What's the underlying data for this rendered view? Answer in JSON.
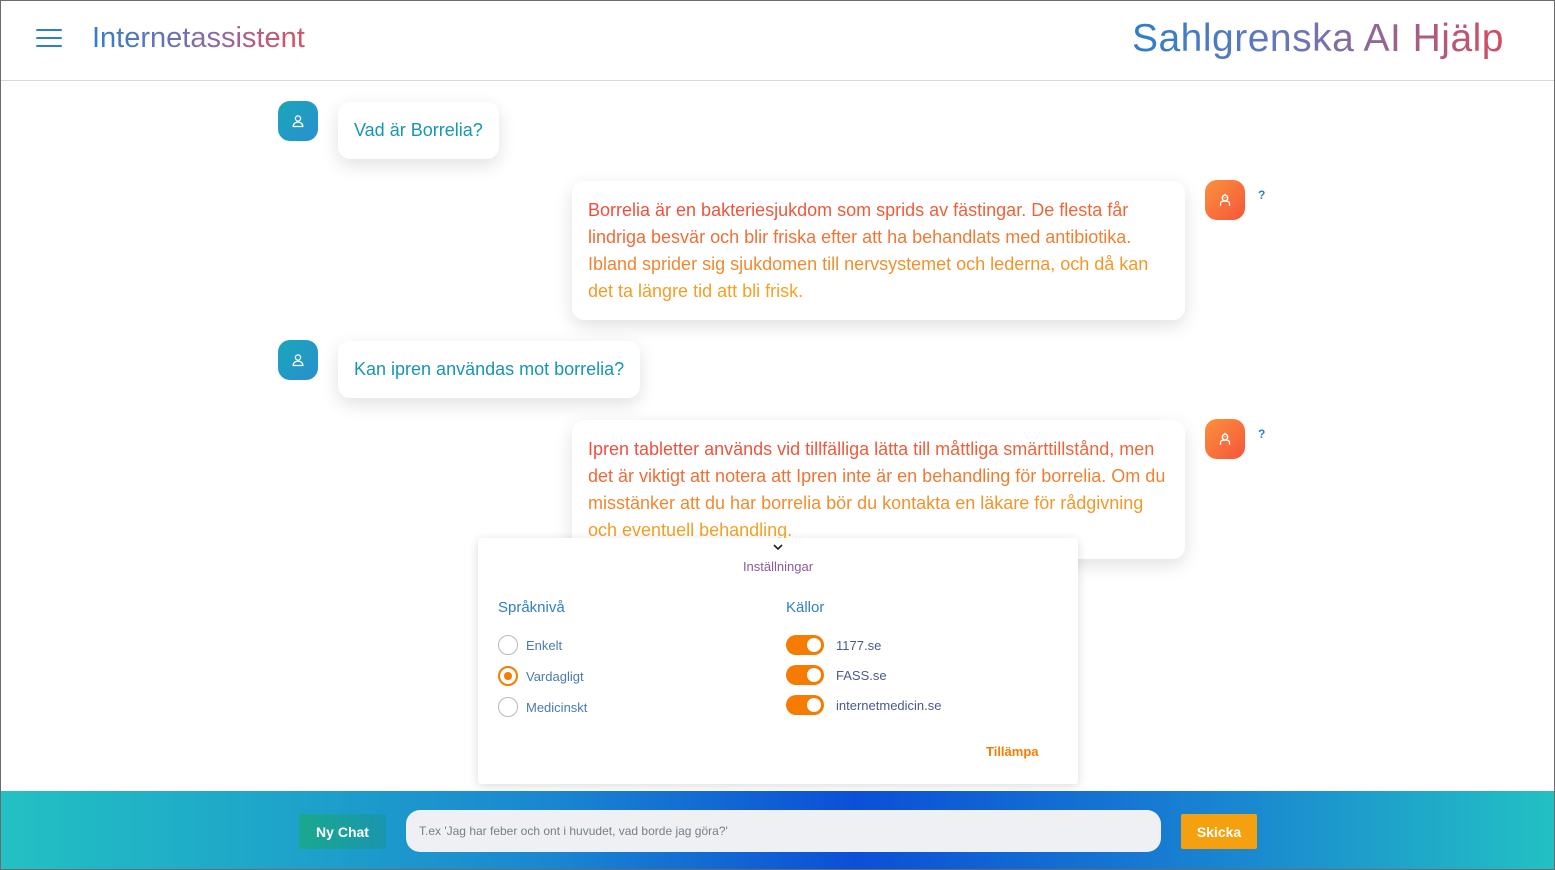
{
  "header": {
    "menu_icon": "hamburger-menu-icon",
    "app_title": "Internetassistent",
    "brand_title": "Sahlgrenska AI Hjälp"
  },
  "messages": [
    {
      "role": "user",
      "icon": "user-icon",
      "text": "Vad är Borrelia?"
    },
    {
      "role": "assistant",
      "icon": "robot-icon",
      "help": "?",
      "text": "Borrelia är en bakteriesjukdom som sprids av fästingar. De flesta får lindriga besvär och blir friska efter att ha behandlats med antibiotika. Ibland sprider sig sjukdomen till nervsystemet och lederna, och då kan det ta längre tid att bli frisk."
    },
    {
      "role": "user",
      "icon": "user-icon",
      "text": "Kan ipren användas mot borrelia?"
    },
    {
      "role": "assistant",
      "icon": "robot-icon",
      "help": "?",
      "text": "Ipren tabletter används vid tillfälliga lätta till måttliga smärttillstånd, men det är viktigt att notera att Ipren inte är en behandling för borrelia. Om du misstänker att du har borrelia bör du kontakta en läkare för rådgivning och eventuell behandling."
    }
  ],
  "settings": {
    "title": "Inställningar",
    "language_level": {
      "title": "Språknivå",
      "options": [
        "Enkelt",
        "Vardagligt",
        "Medicinskt"
      ],
      "selected": "Vardagligt"
    },
    "sources": {
      "title": "Källor",
      "items": [
        {
          "label": "1177.se",
          "enabled": true
        },
        {
          "label": "FASS.se",
          "enabled": true
        },
        {
          "label": "internetmedicin.se",
          "enabled": true
        }
      ]
    },
    "apply_label": "Tillämpa"
  },
  "footer": {
    "new_chat_label": "Ny Chat",
    "input_placeholder": "T.ex 'Jag har feber och ont i huvudet, vad borde jag göra?'",
    "input_value": "",
    "send_label": "Skicka"
  },
  "colors": {
    "accent_orange": "#f57c00",
    "brand_blue": "#2f7fc9",
    "user_text": "#1795b5"
  }
}
